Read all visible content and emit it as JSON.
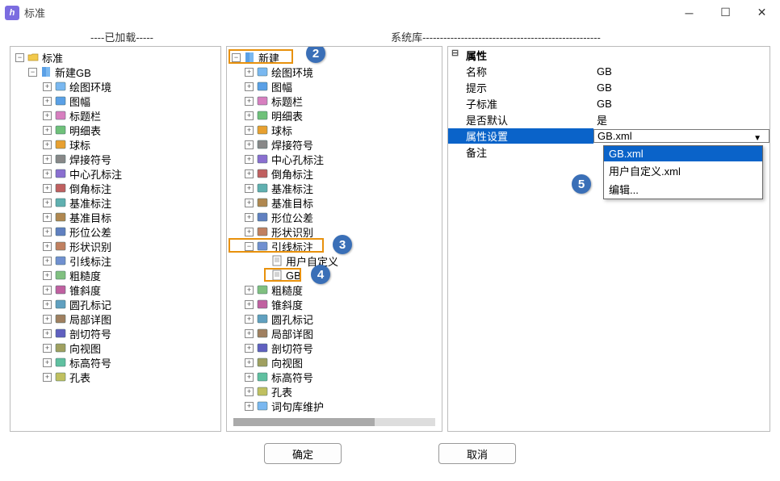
{
  "window": {
    "title": "标准"
  },
  "headers": {
    "loaded": "----已加载-----",
    "syslib": "系统库---------------------------------------------------"
  },
  "leftTree": {
    "root": "标准",
    "sub": "新建GB",
    "items": [
      "绘图环境",
      "图幅",
      "标题栏",
      "明细表",
      "球标",
      "焊接符号",
      "中心孔标注",
      "倒角标注",
      "基准标注",
      "基准目标",
      "形位公差",
      "形状识别",
      "引线标注",
      "粗糙度",
      "锥斜度",
      "圆孔标记",
      "局部详图",
      "剖切符号",
      "向视图",
      "标高符号",
      "孔表"
    ]
  },
  "midTree": {
    "root": "新建",
    "items1": [
      "绘图环境",
      "图幅",
      "标题栏",
      "明细表",
      "球标",
      "焊接符号",
      "中心孔标注",
      "倒角标注",
      "基准标注",
      "基准目标",
      "形位公差",
      "形状识别"
    ],
    "leader": "引线标注",
    "leaderChildren": [
      "用户自定义",
      "GB"
    ],
    "items2": [
      "粗糙度",
      "锥斜度",
      "圆孔标记",
      "局部详图",
      "剖切符号",
      "向视图",
      "标高符号",
      "孔表",
      "词句库维护"
    ]
  },
  "props": {
    "header": "属性",
    "rows": [
      {
        "k": "名称",
        "v": "GB"
      },
      {
        "k": "提示",
        "v": "GB"
      },
      {
        "k": "子标准",
        "v": "GB"
      },
      {
        "k": "是否默认",
        "v": "是"
      },
      {
        "k": "属性设置",
        "v": "GB.xml",
        "selected": true
      },
      {
        "k": "备注",
        "v": ""
      }
    ],
    "dropdown": [
      "GB.xml",
      "用户自定义.xml",
      "编辑..."
    ]
  },
  "badges": {
    "b2": "2",
    "b3": "3",
    "b4": "4",
    "b5": "5"
  },
  "footer": {
    "ok": "确定",
    "cancel": "取消"
  }
}
